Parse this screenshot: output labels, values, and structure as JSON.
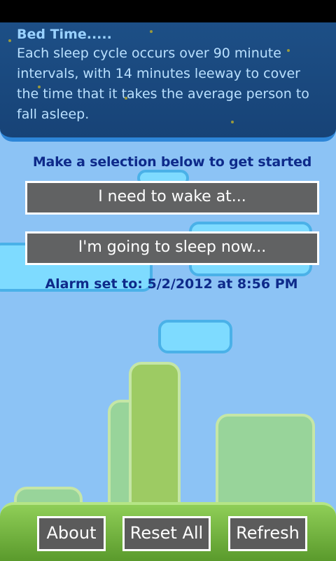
{
  "info": {
    "title": "Bed Time.....",
    "text": "Each sleep cycle occurs over 90 minute intervals, with 14 minutes leeway to cover the time that it takes the average person to fall asleep."
  },
  "prompt": "Make a selection below to get started",
  "buttons": {
    "wake": "I need to wake at...",
    "sleep": "I'm going to sleep now..."
  },
  "alarm": "Alarm set to: 5/2/2012 at 8:56 PM",
  "bottom": {
    "about": "About",
    "reset": "Reset All",
    "refresh": "Refresh"
  }
}
